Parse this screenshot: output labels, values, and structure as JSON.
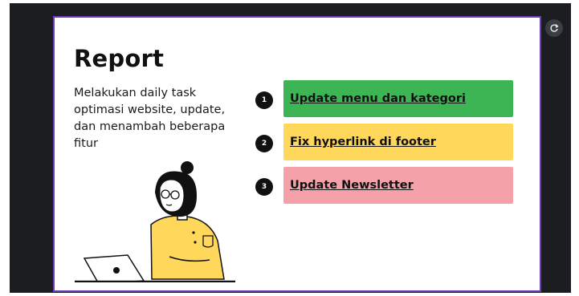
{
  "slide": {
    "title": "Report",
    "description": "Melakukan daily task optimasi website, update, dan menambah beberapa fitur",
    "tasks": [
      {
        "number": "1",
        "label": "Update menu dan kategori",
        "color": "#3db554"
      },
      {
        "number": "2",
        "label": "Fix hyperlink di footer",
        "color": "#ffd75a"
      },
      {
        "number": "3",
        "label": "Update Newsletter",
        "color": "#f5a1aa"
      }
    ]
  },
  "colors": {
    "viewer_background": "#1b1d20",
    "slide_border": "#6b3bb8"
  },
  "icons": {
    "refresh": "refresh-icon",
    "illustration": "person-with-laptop-illustration"
  }
}
